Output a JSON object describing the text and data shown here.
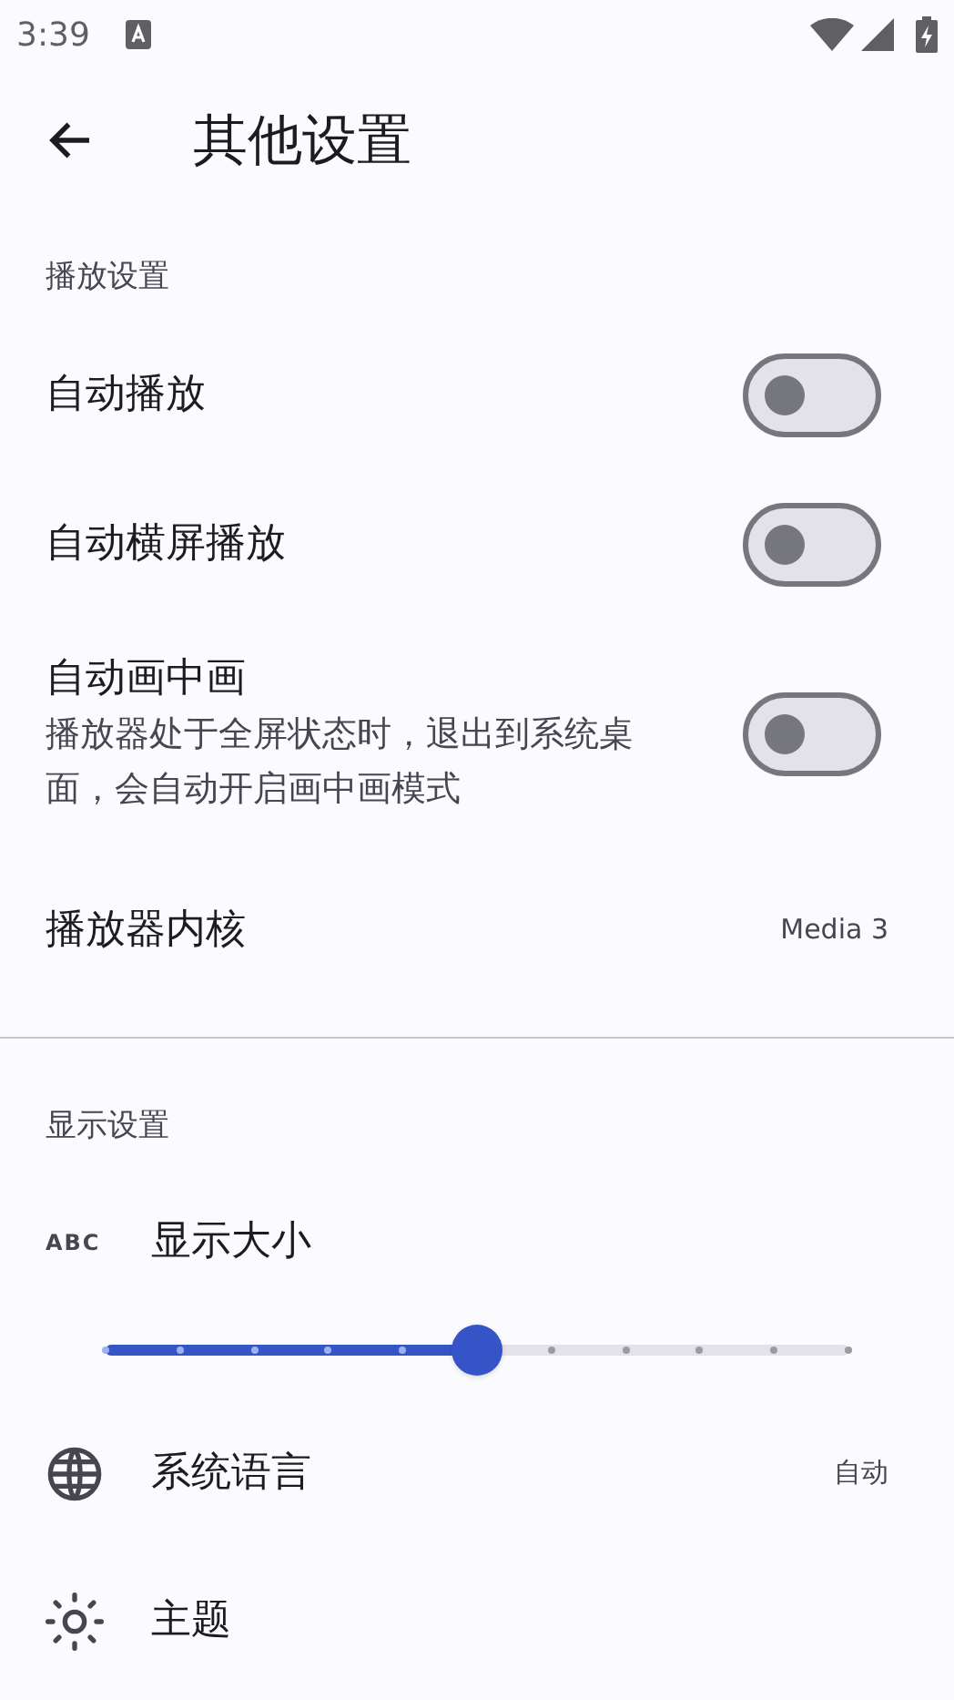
{
  "status_bar": {
    "time": "3:39"
  },
  "header": {
    "title": "其他设置"
  },
  "sections": [
    {
      "title": "播放设置",
      "items": [
        {
          "kind": "switch",
          "label": "自动播放",
          "on": false
        },
        {
          "kind": "switch",
          "label": "自动横屏播放",
          "on": false
        },
        {
          "kind": "switch",
          "label": "自动画中画",
          "description": "播放器处于全屏状态时，退出到系统桌面，会自动开启画中画模式",
          "on": false
        },
        {
          "kind": "value",
          "label": "播放器内核",
          "value": "Media 3"
        }
      ]
    },
    {
      "title": "显示设置",
      "items": [
        {
          "kind": "slider",
          "icon_text": "ABC",
          "label": "显示大小",
          "level": 0.5
        },
        {
          "kind": "icon_value",
          "label": "系统语言",
          "value": "自动"
        },
        {
          "kind": "icon_value",
          "label": "主题"
        }
      ]
    }
  ]
}
